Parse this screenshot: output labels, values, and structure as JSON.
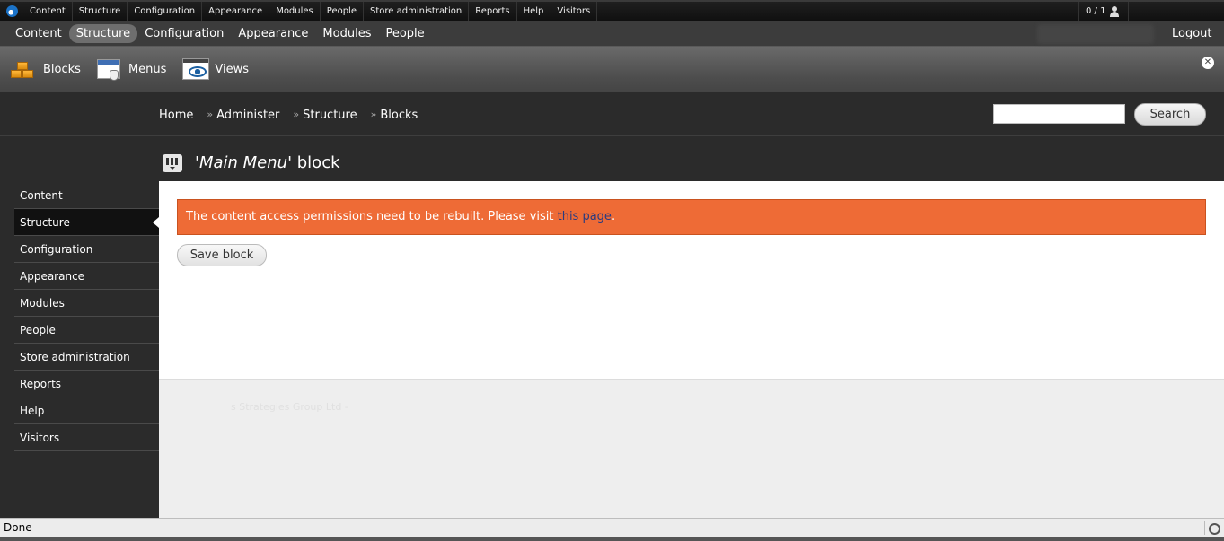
{
  "admin_menu": {
    "items": [
      "Content",
      "Structure",
      "Configuration",
      "Appearance",
      "Modules",
      "People",
      "Store administration",
      "Reports",
      "Help",
      "Visitors"
    ],
    "users_count": "0 / 1"
  },
  "toolbar": {
    "items": [
      {
        "label": "Content",
        "active": false
      },
      {
        "label": "Structure",
        "active": true
      },
      {
        "label": "Configuration",
        "active": false
      },
      {
        "label": "Appearance",
        "active": false
      },
      {
        "label": "Modules",
        "active": false
      },
      {
        "label": "People",
        "active": false
      }
    ],
    "logout": "Logout"
  },
  "shortcuts": {
    "items": [
      {
        "label": "Blocks",
        "icon": "blocks-icon"
      },
      {
        "label": "Menus",
        "icon": "menus-icon"
      },
      {
        "label": "Views",
        "icon": "views-icon"
      }
    ]
  },
  "breadcrumb": [
    "Home",
    "Administer",
    "Structure",
    "Blocks"
  ],
  "search": {
    "button": "Search",
    "value": ""
  },
  "sidebar": {
    "items": [
      {
        "label": "Content",
        "active": false
      },
      {
        "label": "Structure",
        "active": true
      },
      {
        "label": "Configuration",
        "active": false
      },
      {
        "label": "Appearance",
        "active": false
      },
      {
        "label": "Modules",
        "active": false
      },
      {
        "label": "People",
        "active": false
      },
      {
        "label": "Store administration",
        "active": false
      },
      {
        "label": "Reports",
        "active": false
      },
      {
        "label": "Help",
        "active": false
      },
      {
        "label": "Visitors",
        "active": false
      }
    ]
  },
  "page": {
    "title_quote_open": "'",
    "title_em": "Main Menu",
    "title_rest": "' block"
  },
  "message": {
    "text": "The content access permissions need to be rebuilt. Please visit ",
    "link": "this page",
    "suffix": "."
  },
  "form": {
    "save_button": "Save block"
  },
  "footer": {
    "text": "s Strategies Group Ltd -"
  },
  "statusbar": {
    "text": "Done"
  },
  "colors": {
    "message_bg": "#ee6b36",
    "link": "#2a3b80",
    "dark_bg": "#2b2b2b"
  }
}
